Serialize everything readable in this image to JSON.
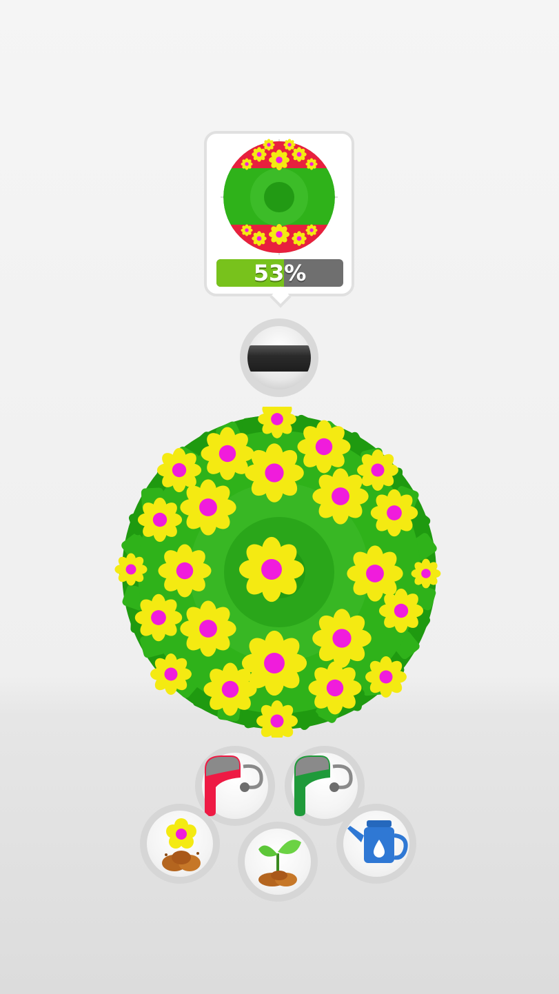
{
  "target": {
    "progress_percent": 53,
    "progress_label": "53%"
  },
  "colors": {
    "leaf": "#2fb21a",
    "leaf_dark": "#1f9a10",
    "petal": "#f4ea12",
    "flower_center": "#f01cdc",
    "target_band": "#e8203e",
    "progress_fill": "#78c21c",
    "progress_track": "#6f6f6f",
    "paint_red": "#ee1a44",
    "paint_green": "#1f9a3a",
    "watering_can": "#2f78d4"
  },
  "tools": {
    "red_paint_bucket": {
      "icon": "red-paint-bucket-icon"
    },
    "green_paint_bucket": {
      "icon": "green-paint-bucket-icon"
    },
    "flower_seeds": {
      "icon": "flower-seed-icon"
    },
    "sprout": {
      "icon": "sprout-icon"
    },
    "watering_can": {
      "icon": "watering-can-icon"
    }
  }
}
